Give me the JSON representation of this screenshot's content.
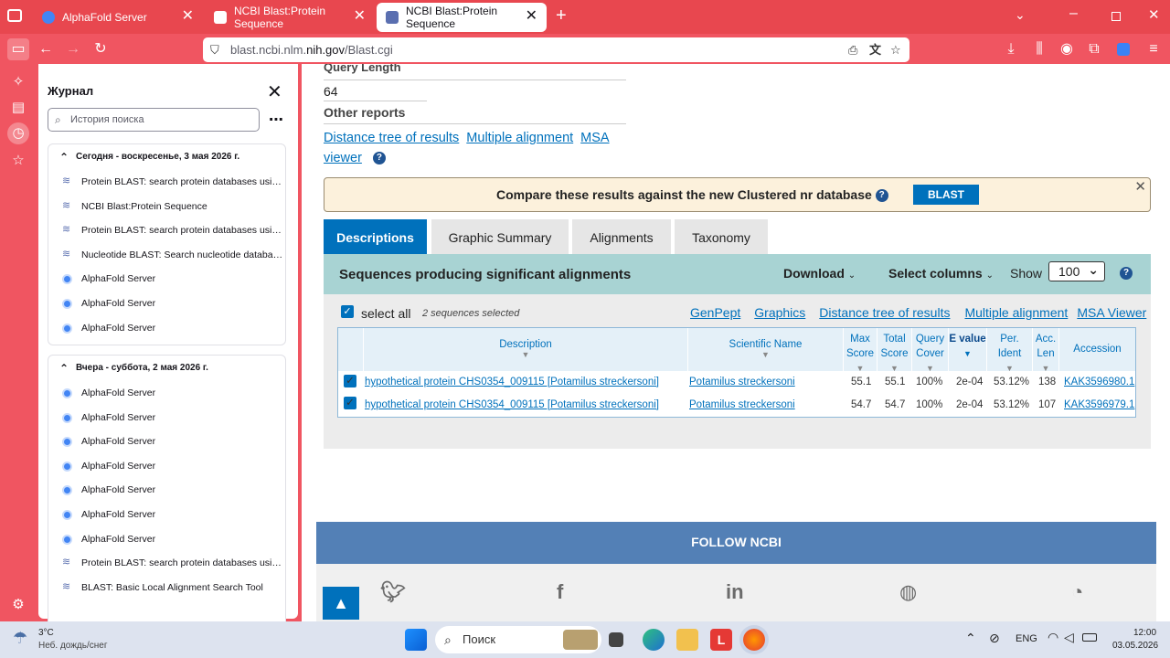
{
  "tabs": [
    {
      "title": "AlphaFold Server"
    },
    {
      "title": "NCBI Blast:Protein Sequence"
    },
    {
      "title": "NCBI Blast:Protein Sequence"
    }
  ],
  "url": {
    "host": "blast.ncbi.nlm.",
    "domain": "nih.gov",
    "path": "/Blast.cgi"
  },
  "sidebar": {
    "title": "Журнал",
    "search_placeholder": "История поиска",
    "today": {
      "header": "Сегодня - воскресенье, 3 мая 2026 г.",
      "items": [
        {
          "label": "Protein BLAST: search protein databases using ...",
          "icon": "blast"
        },
        {
          "label": "NCBI Blast:Protein Sequence",
          "icon": "blast"
        },
        {
          "label": "Protein BLAST: search protein databases using ...",
          "icon": "blast"
        },
        {
          "label": "Nucleotide BLAST: Search nucleotide database...",
          "icon": "blast"
        },
        {
          "label": "AlphaFold Server",
          "icon": "alphafold"
        },
        {
          "label": "AlphaFold Server",
          "icon": "alphafold"
        },
        {
          "label": "AlphaFold Server",
          "icon": "alphafold"
        }
      ]
    },
    "yesterday": {
      "header": "Вчера - суббота, 2 мая 2026 г.",
      "items": [
        {
          "label": "AlphaFold Server",
          "icon": "alphafold"
        },
        {
          "label": "AlphaFold Server",
          "icon": "alphafold"
        },
        {
          "label": "AlphaFold Server",
          "icon": "alphafold"
        },
        {
          "label": "AlphaFold Server",
          "icon": "alphafold"
        },
        {
          "label": "AlphaFold Server",
          "icon": "alphafold"
        },
        {
          "label": "AlphaFold Server",
          "icon": "alphafold"
        },
        {
          "label": "AlphaFold Server",
          "icon": "alphafold"
        },
        {
          "label": "Protein BLAST: search protein databases using ...",
          "icon": "blast"
        },
        {
          "label": "BLAST: Basic Local Alignment Search Tool",
          "icon": "blast"
        }
      ]
    }
  },
  "content": {
    "query_length_label": "Query Length",
    "query_length_value": "64",
    "other_reports_label": "Other reports",
    "reports": [
      "Distance tree of results",
      "Multiple alignment",
      "MSA",
      "viewer"
    ],
    "banner_text": "Compare these results against the new Clustered nr database",
    "banner_button": "BLAST",
    "result_tabs": [
      "Descriptions",
      "Graphic Summary",
      "Alignments",
      "Taxonomy"
    ],
    "panel_title": "Sequences producing significant alignments",
    "download_label": "Download",
    "select_columns_label": "Select columns",
    "show_label": "Show",
    "show_value": "100",
    "select_all_label": "select all",
    "selected_note": "2 sequences selected",
    "links": [
      "GenPept",
      "Graphics",
      "Distance tree of results",
      "Multiple alignment",
      "MSA Viewer"
    ],
    "columns": [
      "Description",
      "Scientific Name",
      "Max Score",
      "Total Score",
      "Query Cover",
      "E value",
      "Per. Ident",
      "Acc. Len",
      "Accession"
    ],
    "rows": [
      {
        "description": "hypothetical protein CHS0354_009115 [Potamilus streckersoni]",
        "sciname": "Potamilus streckersoni",
        "max": "55.1",
        "total": "55.1",
        "cover": "100%",
        "evalue": "2e-04",
        "ident": "53.12%",
        "len": "138",
        "acc": "KAK3596980.1"
      },
      {
        "description": "hypothetical protein CHS0354_009115 [Potamilus streckersoni]",
        "sciname": "Potamilus streckersoni",
        "max": "54.7",
        "total": "54.7",
        "cover": "100%",
        "evalue": "2e-04",
        "ident": "53.12%",
        "len": "107",
        "acc": "KAK3596979.1"
      }
    ],
    "footer_title": "FOLLOW NCBI"
  },
  "taskbar": {
    "weather_temp": "3°C",
    "weather_desc": "Неб. дождь/снег",
    "search_placeholder": "Поиск",
    "lang": "ENG",
    "time": "12:00",
    "date": "03.05.2026"
  }
}
